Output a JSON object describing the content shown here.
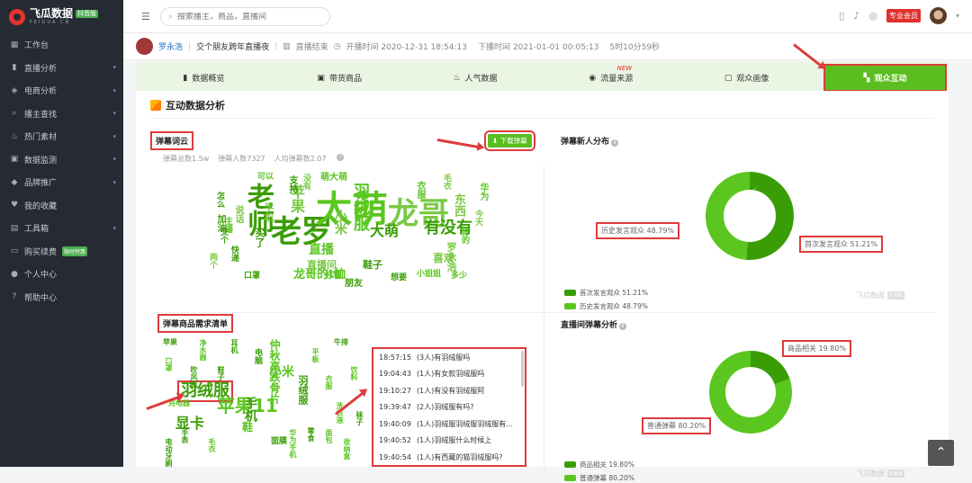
{
  "app": {
    "name": "飞瓜数据",
    "edition": "抖音版",
    "sub": "FEIGUA.CN"
  },
  "sidebar": {
    "items": [
      {
        "label": "工作台",
        "icon": "grid-icon",
        "chev": false
      },
      {
        "label": "直播分析",
        "icon": "bars-icon",
        "chev": true
      },
      {
        "label": "电商分析",
        "icon": "bag-icon",
        "chev": true
      },
      {
        "label": "播主查找",
        "icon": "search-icon",
        "chev": true
      },
      {
        "label": "热门素材",
        "icon": "fire-icon",
        "chev": true
      },
      {
        "label": "数据监测",
        "icon": "monitor-icon",
        "chev": true
      },
      {
        "label": "品牌推广",
        "icon": "diamond-icon",
        "chev": true
      },
      {
        "label": "我的收藏",
        "icon": "heart-icon",
        "chev": false
      },
      {
        "label": "工具箱",
        "icon": "toolbox-icon",
        "chev": true
      },
      {
        "label": "购买续费",
        "icon": "card-icon",
        "chev": false,
        "badge": "限时特惠"
      },
      {
        "label": "个人中心",
        "icon": "user-icon",
        "chev": false
      },
      {
        "label": "帮助中心",
        "icon": "help-icon",
        "chev": false
      }
    ]
  },
  "top": {
    "search_placeholder": "搜索播主，商品，直播间",
    "vip": "专业会员"
  },
  "info": {
    "host": "罗永浩",
    "title": "交个朋友跨年直播夜",
    "status": "直播结束",
    "start": "开播时间 2020-12-31 18:54:13",
    "end": "下播时间 2021-01-01 00:05:13",
    "duration": "5时10分59秒"
  },
  "tabs": [
    {
      "label": "数据概览",
      "icon": "chart-icon"
    },
    {
      "label": "带货商品",
      "icon": "cart-icon"
    },
    {
      "label": "人气数据",
      "icon": "flame-icon"
    },
    {
      "label": "流量来源",
      "icon": "flow-icon",
      "badge": "NEW"
    },
    {
      "label": "观众画像",
      "icon": "scan-icon"
    },
    {
      "label": "观众互动",
      "icon": "chat-icon",
      "active": true
    }
  ],
  "section": {
    "title": "互动数据分析"
  },
  "wordcloud": {
    "label": "弹幕词云",
    "download": "下载弹幕",
    "stats": [
      "弹幕总数1.5w",
      "弹幕人数7327",
      "人均弹幕数2.07"
    ],
    "words": [
      "老罗",
      "太萌",
      "龙哥",
      "老师",
      "直播",
      "苹果",
      "有没有",
      "羽绒服",
      "小米",
      "大萌",
      "龙哥的t恤",
      "手机",
      "鞋子",
      "华为",
      "东西",
      "支持",
      "好看",
      "喜欢",
      "朋友",
      "萌大萌",
      "直播间",
      "加油",
      "衣服",
      "毛衣",
      "买了",
      "主播",
      "罗永浩",
      "快递",
      "小姐姐",
      "说话",
      "想要",
      "可以",
      "没有",
      "交个",
      "好的",
      "今天",
      "怎么",
      "多少",
      "两个",
      "口罩"
    ]
  },
  "newcomers": {
    "label": "弹幕新人分布",
    "legend": [
      "首次发言观众 51.21%",
      "历史发言观众 48.79%"
    ],
    "first_label": "首次发言观众 51.21%",
    "hist_label": "历史发言观众 48.79%",
    "values": [
      51.21,
      48.79
    ],
    "colors": [
      "#3a9d06",
      "#5bc61f"
    ]
  },
  "demand": {
    "label": "弹幕商品需求清单",
    "words": [
      "羽绒服",
      "苹果11",
      "显卡",
      "小米",
      "手机",
      "鞋",
      "羽绒服",
      "仲秋高跌骨片",
      "苹果",
      "充电器",
      "牛排",
      "净水器",
      "耳机",
      "平板",
      "电脑",
      "口罩",
      "面膜",
      "衣服",
      "零食",
      "洗衣液",
      "手表",
      "华为手机",
      "鞋子",
      "饮料",
      "吹风机",
      "面包",
      "袜子",
      "毛衣",
      "电动牙刷",
      "收纳盒"
    ],
    "messages": [
      {
        "time": "18:57:15",
        "text": "(3人)有羽绒服吗"
      },
      {
        "time": "19:04:43",
        "text": "(1人)有女款羽绒服吗"
      },
      {
        "time": "19:10:27",
        "text": "(1人)有没有羽绒服阿"
      },
      {
        "time": "19:39:47",
        "text": "(2人)羽绒服有吗?"
      },
      {
        "time": "19:40:09",
        "text": "(1人)羽绒服羽绒服羽绒服有..."
      },
      {
        "time": "19:40:52",
        "text": "(1人)羽绒服什么时候上"
      },
      {
        "time": "19:40:54",
        "text": "(1人)有西藏的猫羽绒服吗?"
      }
    ]
  },
  "barrage": {
    "label": "直播间弹幕分析",
    "legend": [
      "商品相关 19.80%",
      "普通弹幕 80.20%"
    ],
    "product_label": "商品相关 19.80%",
    "normal_label": "普通弹幕 80.20%",
    "values": [
      19.8,
      80.2
    ],
    "colors": [
      "#3a9d06",
      "#5bc61f"
    ]
  },
  "watermark": "飞瓜数据"
}
